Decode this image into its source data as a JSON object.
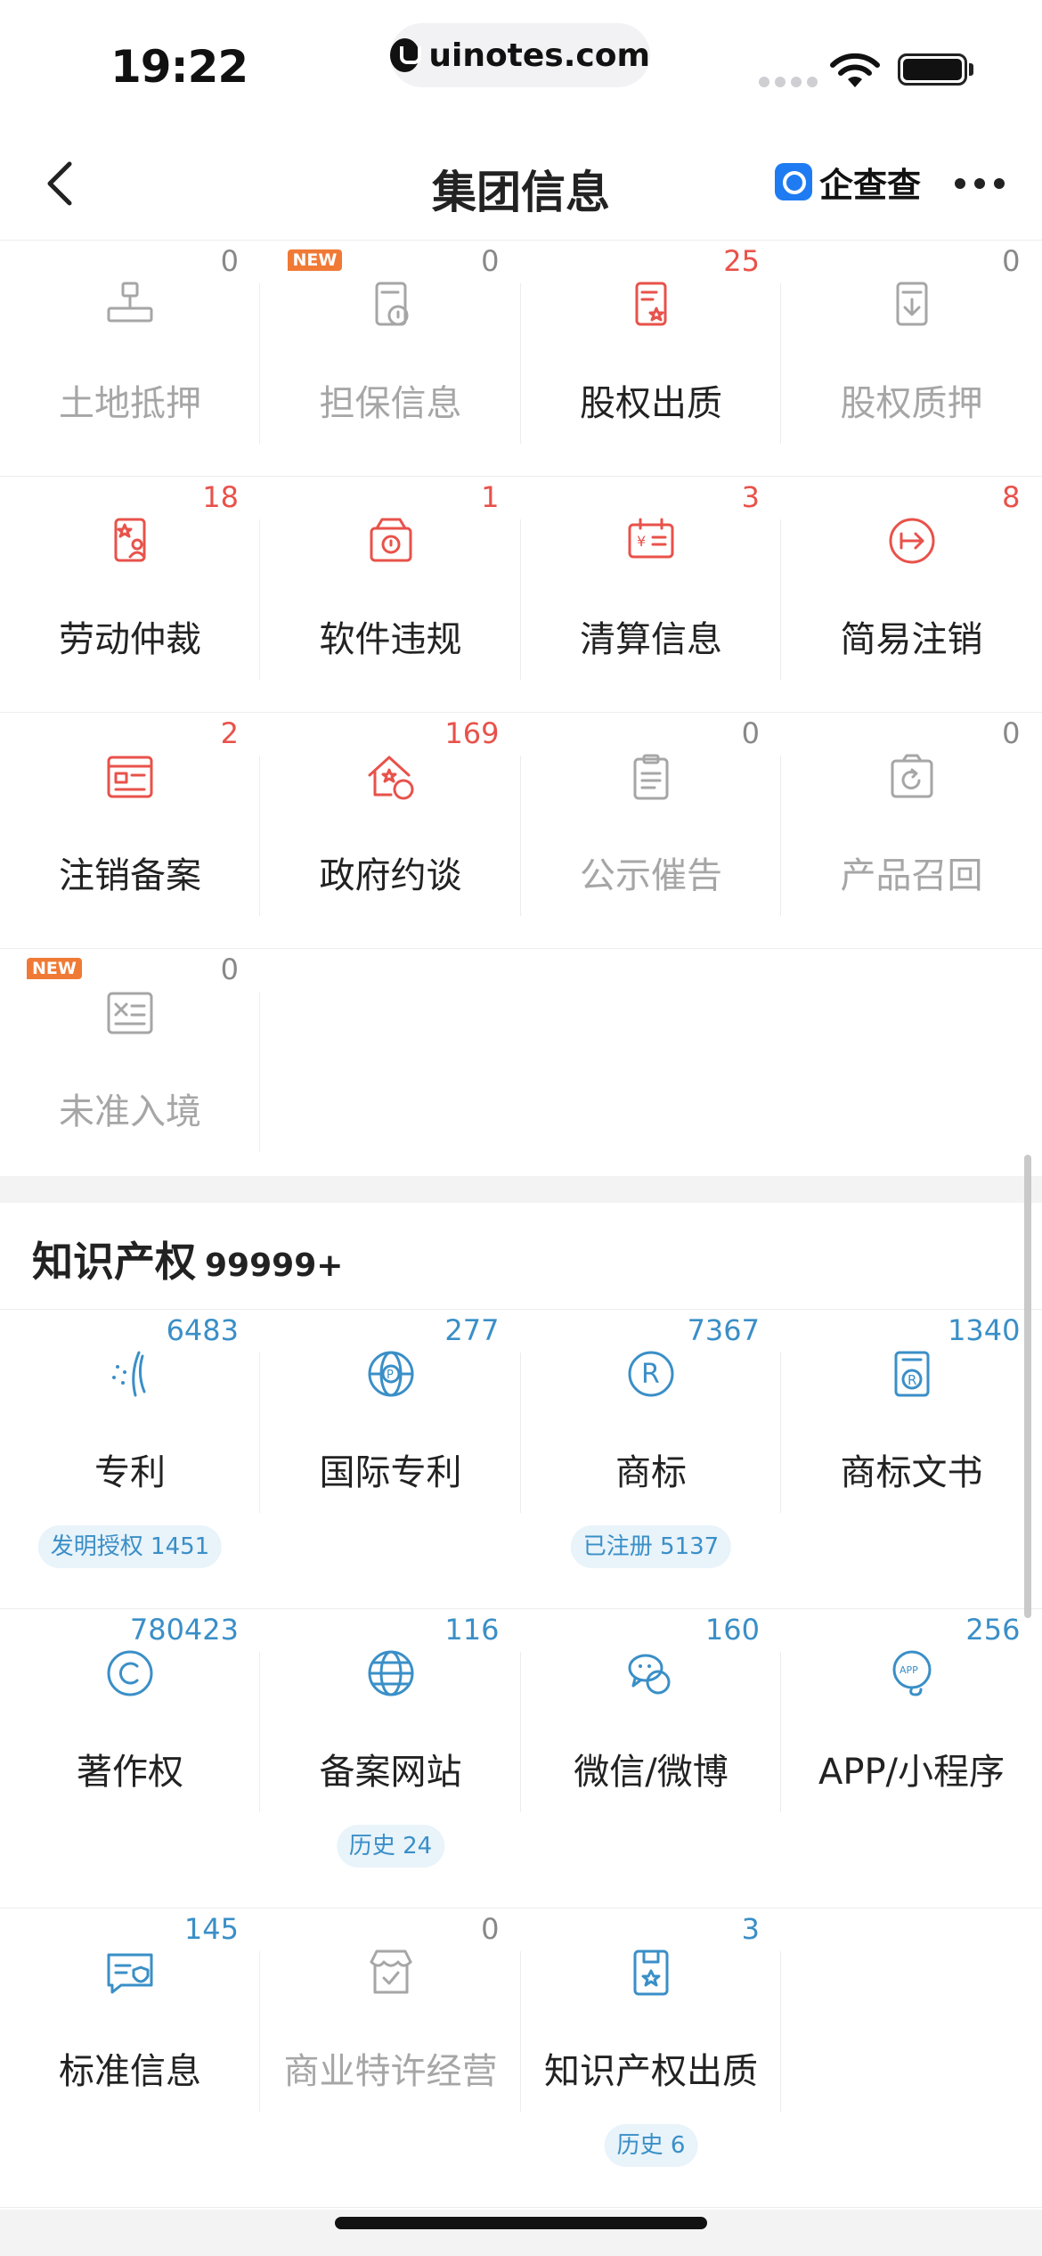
{
  "status_bar": {
    "time": "19:22",
    "url": "uinotes.com"
  },
  "nav": {
    "title": "集团信息",
    "brand": "企查查"
  },
  "risk_grid": [
    {
      "label": "土地抵押",
      "count": "0",
      "active": false,
      "new": false,
      "icon": "land-mortgage-icon"
    },
    {
      "label": "担保信息",
      "count": "0",
      "active": false,
      "new": true,
      "icon": "guarantee-icon"
    },
    {
      "label": "股权出质",
      "count": "25",
      "active": true,
      "new": false,
      "icon": "equity-pledge-icon"
    },
    {
      "label": "股权质押",
      "count": "0",
      "active": false,
      "new": false,
      "icon": "share-pledge-icon"
    },
    {
      "label": "劳动仲裁",
      "count": "18",
      "active": true,
      "new": false,
      "icon": "labor-arbitration-icon"
    },
    {
      "label": "软件违规",
      "count": "1",
      "active": true,
      "new": false,
      "icon": "software-violation-icon"
    },
    {
      "label": "清算信息",
      "count": "3",
      "active": true,
      "new": false,
      "icon": "liquidation-icon"
    },
    {
      "label": "简易注销",
      "count": "8",
      "active": true,
      "new": false,
      "icon": "simple-deregistration-icon"
    },
    {
      "label": "注销备案",
      "count": "2",
      "active": true,
      "new": false,
      "icon": "deregistration-filing-icon"
    },
    {
      "label": "政府约谈",
      "count": "169",
      "active": true,
      "new": false,
      "icon": "government-interview-icon"
    },
    {
      "label": "公示催告",
      "count": "0",
      "active": false,
      "new": false,
      "icon": "public-notice-icon"
    },
    {
      "label": "产品召回",
      "count": "0",
      "active": false,
      "new": false,
      "icon": "product-recall-icon"
    },
    {
      "label": "未准入境",
      "count": "0",
      "active": false,
      "new": true,
      "icon": "entry-denied-icon"
    }
  ],
  "new_badge": "NEW",
  "ip_section": {
    "title": "知识产权",
    "count": "99999+"
  },
  "ip_grid": [
    {
      "label": "专利",
      "count": "6483",
      "active": true,
      "tag": "发明授权 1451",
      "icon": "patent-icon"
    },
    {
      "label": "国际专利",
      "count": "277",
      "active": true,
      "tag": "",
      "icon": "international-patent-icon"
    },
    {
      "label": "商标",
      "count": "7367",
      "active": true,
      "tag": "已注册 5137",
      "icon": "trademark-icon"
    },
    {
      "label": "商标文书",
      "count": "1340",
      "active": true,
      "tag": "",
      "icon": "trademark-document-icon"
    },
    {
      "label": "著作权",
      "count": "780423",
      "active": true,
      "tag": "",
      "icon": "copyright-icon"
    },
    {
      "label": "备案网站",
      "count": "116",
      "active": true,
      "tag": "历史 24",
      "icon": "website-icon"
    },
    {
      "label": "微信/微博",
      "count": "160",
      "active": true,
      "tag": "",
      "icon": "wechat-weibo-icon"
    },
    {
      "label": "APP/小程序",
      "count": "256",
      "active": true,
      "tag": "",
      "icon": "app-icon"
    },
    {
      "label": "标准信息",
      "count": "145",
      "active": true,
      "tag": "",
      "icon": "standard-info-icon"
    },
    {
      "label": "商业特许经营",
      "count": "0",
      "active": false,
      "tag": "",
      "icon": "franchise-icon"
    },
    {
      "label": "知识产权出质",
      "count": "3",
      "active": true,
      "tag": "历史 6",
      "icon": "ip-pledge-icon"
    }
  ],
  "colors": {
    "red": "#e8524a",
    "blue": "#3a8fc7",
    "gray": "#a6a6a6"
  }
}
